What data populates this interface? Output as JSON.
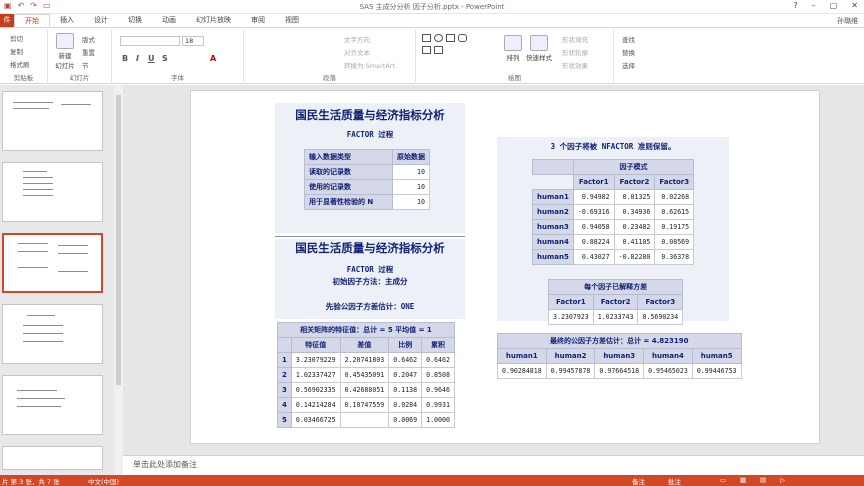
{
  "app": {
    "window_title": "SAS 主成分分析 因子分析.pptx - PowerPoint",
    "user": "孙璐维"
  },
  "tabs": [
    "开始",
    "插入",
    "设计",
    "切换",
    "动画",
    "幻灯片放映",
    "审阅",
    "视图"
  ],
  "file_tab": "件",
  "ribbon": {
    "clipboard": {
      "label": "剪贴板",
      "cut": "剪切",
      "copy": "复制",
      "format_painter": "格式刷"
    },
    "slides": {
      "label": "幻灯片",
      "new_slide": "新建\n幻灯片",
      "layout": "版式",
      "reset": "重置",
      "section": "节"
    },
    "font": {
      "label": "字体",
      "size": "18"
    },
    "paragraph": {
      "label": "段落",
      "text_direction": "文字方向",
      "align_text": "对齐文本",
      "smartart": "转换为 SmartArt"
    },
    "drawing": {
      "label": "绘图",
      "arrange": "排列",
      "quick_styles": "快速样式",
      "shape_fill": "形状填充",
      "shape_outline": "形状轮廓",
      "shape_effects": "形状效果"
    },
    "editing": {
      "find": "查找",
      "replace": "替换",
      "select": "选择"
    }
  },
  "notes_placeholder": "单击此处添加备注",
  "status": {
    "slide_info": "片 第 3 张，共 7 张",
    "language": "中文(中国)",
    "notes": "备注",
    "comments": "批注"
  },
  "slide": {
    "title1": "国民生活质量与经济指标分析",
    "proc1": "FACTOR 过程",
    "input_table": {
      "header": [
        "输入数据类型",
        "原始数据"
      ],
      "rows": [
        [
          "读取的记录数",
          "10"
        ],
        [
          "使用的记录数",
          "10"
        ],
        [
          "用于显著性检验的 N",
          "10"
        ]
      ]
    },
    "title2": "国民生活质量与经济指标分析",
    "proc2": "FACTOR 过程",
    "method": "初始因子方法：主成分",
    "prior": "先验公因子方差估计：ONE",
    "eigen_table": {
      "caption": "相关矩阵的特征值：总计 = 5  平均值 = 1",
      "header": [
        "",
        "特征值",
        "差值",
        "比例",
        "累积"
      ],
      "rows": [
        [
          "1",
          "3.23079229",
          "2.20741803",
          "0.6462",
          "0.6462"
        ],
        [
          "2",
          "1.02337427",
          "0.45435091",
          "0.2047",
          "0.8508"
        ],
        [
          "3",
          "0.56902335",
          "0.42688051",
          "0.1138",
          "0.9646"
        ],
        [
          "4",
          "0.14214284",
          "0.10747559",
          "0.0284",
          "0.9931"
        ],
        [
          "5",
          "0.03466725",
          "",
          "0.0069",
          "1.0000"
        ]
      ]
    },
    "nfactor_note": "3 个因子将被 NFACTOR 准则保留。",
    "pattern_table": {
      "caption": "因子模式",
      "header": [
        "",
        "Factor1",
        "Factor2",
        "Factor3"
      ],
      "rows": [
        [
          "human1",
          "0.94982",
          "0.01325",
          "0.02268"
        ],
        [
          "human2",
          "-0.69316",
          "0.34936",
          "0.62615"
        ],
        [
          "human3",
          "0.94058",
          "0.23482",
          "0.19175"
        ],
        [
          "human4",
          "0.88224",
          "0.41105",
          "0.08569"
        ],
        [
          "human5",
          "0.43027",
          "-0.82280",
          "0.36378"
        ]
      ]
    },
    "explained_table": {
      "caption": "每个因子已解释方差",
      "header": [
        "Factor1",
        "Factor2",
        "Factor3"
      ],
      "rows": [
        [
          "3.2307923",
          "1.0233743",
          "0.5690234"
        ]
      ]
    },
    "communality_table": {
      "caption": "最终的公因子方差估计：总计 = 4.823190",
      "header": [
        "human1",
        "human2",
        "human3",
        "human4",
        "human5"
      ],
      "rows": [
        [
          "0.90284818",
          "0.99457878",
          "0.97664518",
          "0.95465023",
          "0.99446753"
        ]
      ]
    }
  }
}
